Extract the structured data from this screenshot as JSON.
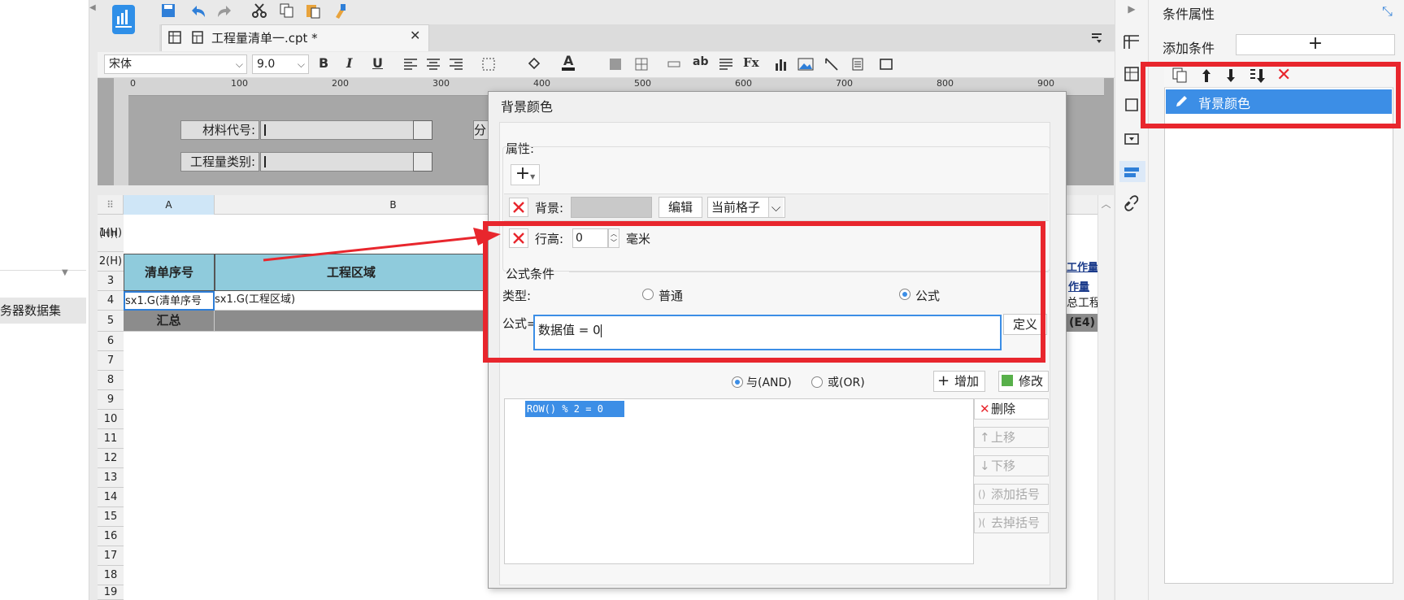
{
  "left": {
    "dataset_label": "务器数据集"
  },
  "tab": {
    "title": "工程量清单一.cpt *"
  },
  "format": {
    "font": "宋体",
    "size": "9.0"
  },
  "ruler": {
    "ticks": [
      "0",
      "100",
      "200",
      "300",
      "400",
      "500",
      "600",
      "700",
      "800",
      "900"
    ]
  },
  "params": {
    "material_code": "材料代号:",
    "quantity_type": "工程量类别:",
    "partial_label": "分"
  },
  "sheet": {
    "columns": [
      "A",
      "B"
    ],
    "rows": [
      "1(H)",
      "2(H)",
      "3",
      "4",
      "5",
      "6",
      "7",
      "8",
      "9",
      "10",
      "11",
      "12",
      "13",
      "14",
      "15",
      "16",
      "17",
      "18",
      "19"
    ],
    "row1_label": "(H)(",
    "header_a": "清单序号",
    "header_b": "工程区域",
    "cell_a4": "sx1.G(清单序号",
    "cell_b4": "sx1.G(工程区域)",
    "sum_label": "汇总",
    "right_h1": "工作量",
    "right_h2": "作量",
    "right_c4": "总工程",
    "right_e4": "(E4)"
  },
  "dialog": {
    "title": "背景颜色",
    "props_label": "属性:",
    "bg_label": "背景:",
    "edit_btn": "编辑",
    "scope": "当前格子",
    "row_height_label": "行高:",
    "row_height_value": "0",
    "unit": "毫米",
    "formula_cond_label": "公式条件",
    "type_label": "类型:",
    "type_normal": "普通",
    "type_formula": "公式",
    "formula_label": "公式=",
    "formula_value": "数据值 = 0",
    "define_btn": "定义",
    "and_label": "与(AND)",
    "or_label": "或(OR)",
    "add_btn": "增加",
    "modify_btn": "修改",
    "condition_item": "ROW() % 2 = 0",
    "delete_btn": "删除",
    "up_btn": "上移",
    "down_btn": "下移",
    "add_paren_btn": "添加括号",
    "remove_paren_btn": "去掉括号"
  },
  "right_panel": {
    "title": "条件属性",
    "add_condition": "添加条件",
    "add_button": "+",
    "item": "背景颜色"
  },
  "colors": {
    "accent": "#3c8ee6",
    "annotation": "#e8262d",
    "header_fill": "#8fcbdc",
    "sum_fill": "#8c8c8c"
  }
}
